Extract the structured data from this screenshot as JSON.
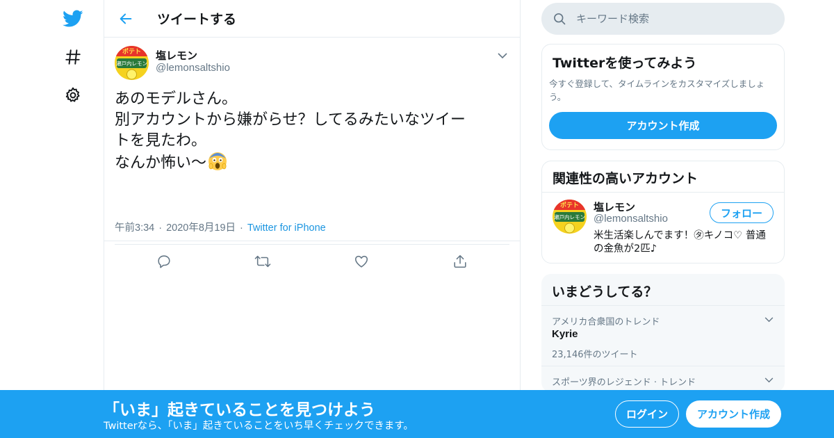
{
  "colors": {
    "brand": "#1da1f2",
    "link": "#1b95e0",
    "text": "#14171a",
    "muted": "#657786",
    "border": "#e6ecf0"
  },
  "nav": {
    "items": [
      {
        "icon": "twitter-bird-icon"
      },
      {
        "icon": "hashtag-icon"
      },
      {
        "icon": "gear-icon"
      }
    ]
  },
  "header": {
    "title": "ツイートする",
    "back_icon": "arrow-left-icon"
  },
  "tweet": {
    "author_name": "塩レモン",
    "author_handle": "@lemonsaltshio",
    "avatar_label": "ポテトチップス 瀬戸内レモン味",
    "text_lines": [
      "あのモデルさん。",
      "別アカウントから嫌がらせ？してるみたいなツイー",
      "トを見たわ。",
      "なんか怖い〜"
    ],
    "emoji": "scream-emoji",
    "time": "午前3:34",
    "date": "2020年8月19日",
    "separator": "·",
    "source": "Twitter for iPhone",
    "actions": [
      "reply-icon",
      "retweet-icon",
      "like-icon",
      "share-icon"
    ]
  },
  "search": {
    "placeholder": "キーワード検索"
  },
  "signup_card": {
    "title": "Twitterを使ってみよう",
    "text": "今すぐ登録して、タイムラインをカスタマイズしましょう。",
    "button": "アカウント作成"
  },
  "related": {
    "title": "関連性の高いアカウント",
    "name": "塩レモン",
    "handle": "@lemonsaltshio",
    "follow": "フォロー",
    "bio": "米生活楽しんでます！㋟キノコ♡ 普通の金魚が2匹♪"
  },
  "trends": {
    "title": "いまどうしてる？",
    "items": [
      {
        "context": "アメリカ合衆国のトレンド",
        "name": "Kyrie",
        "count": "23,146件のツイート"
      },
      {
        "context": "スポーツ界のレジェンド · トレンド",
        "name": "",
        "count": ""
      }
    ]
  },
  "bottom_bar": {
    "title": "「いま」起きていることを見つけよう",
    "subtitle": "Twitterなら、「いま」起きていることをいち早くチェックできます。",
    "login": "ログイン",
    "signup": "アカウント作成"
  }
}
